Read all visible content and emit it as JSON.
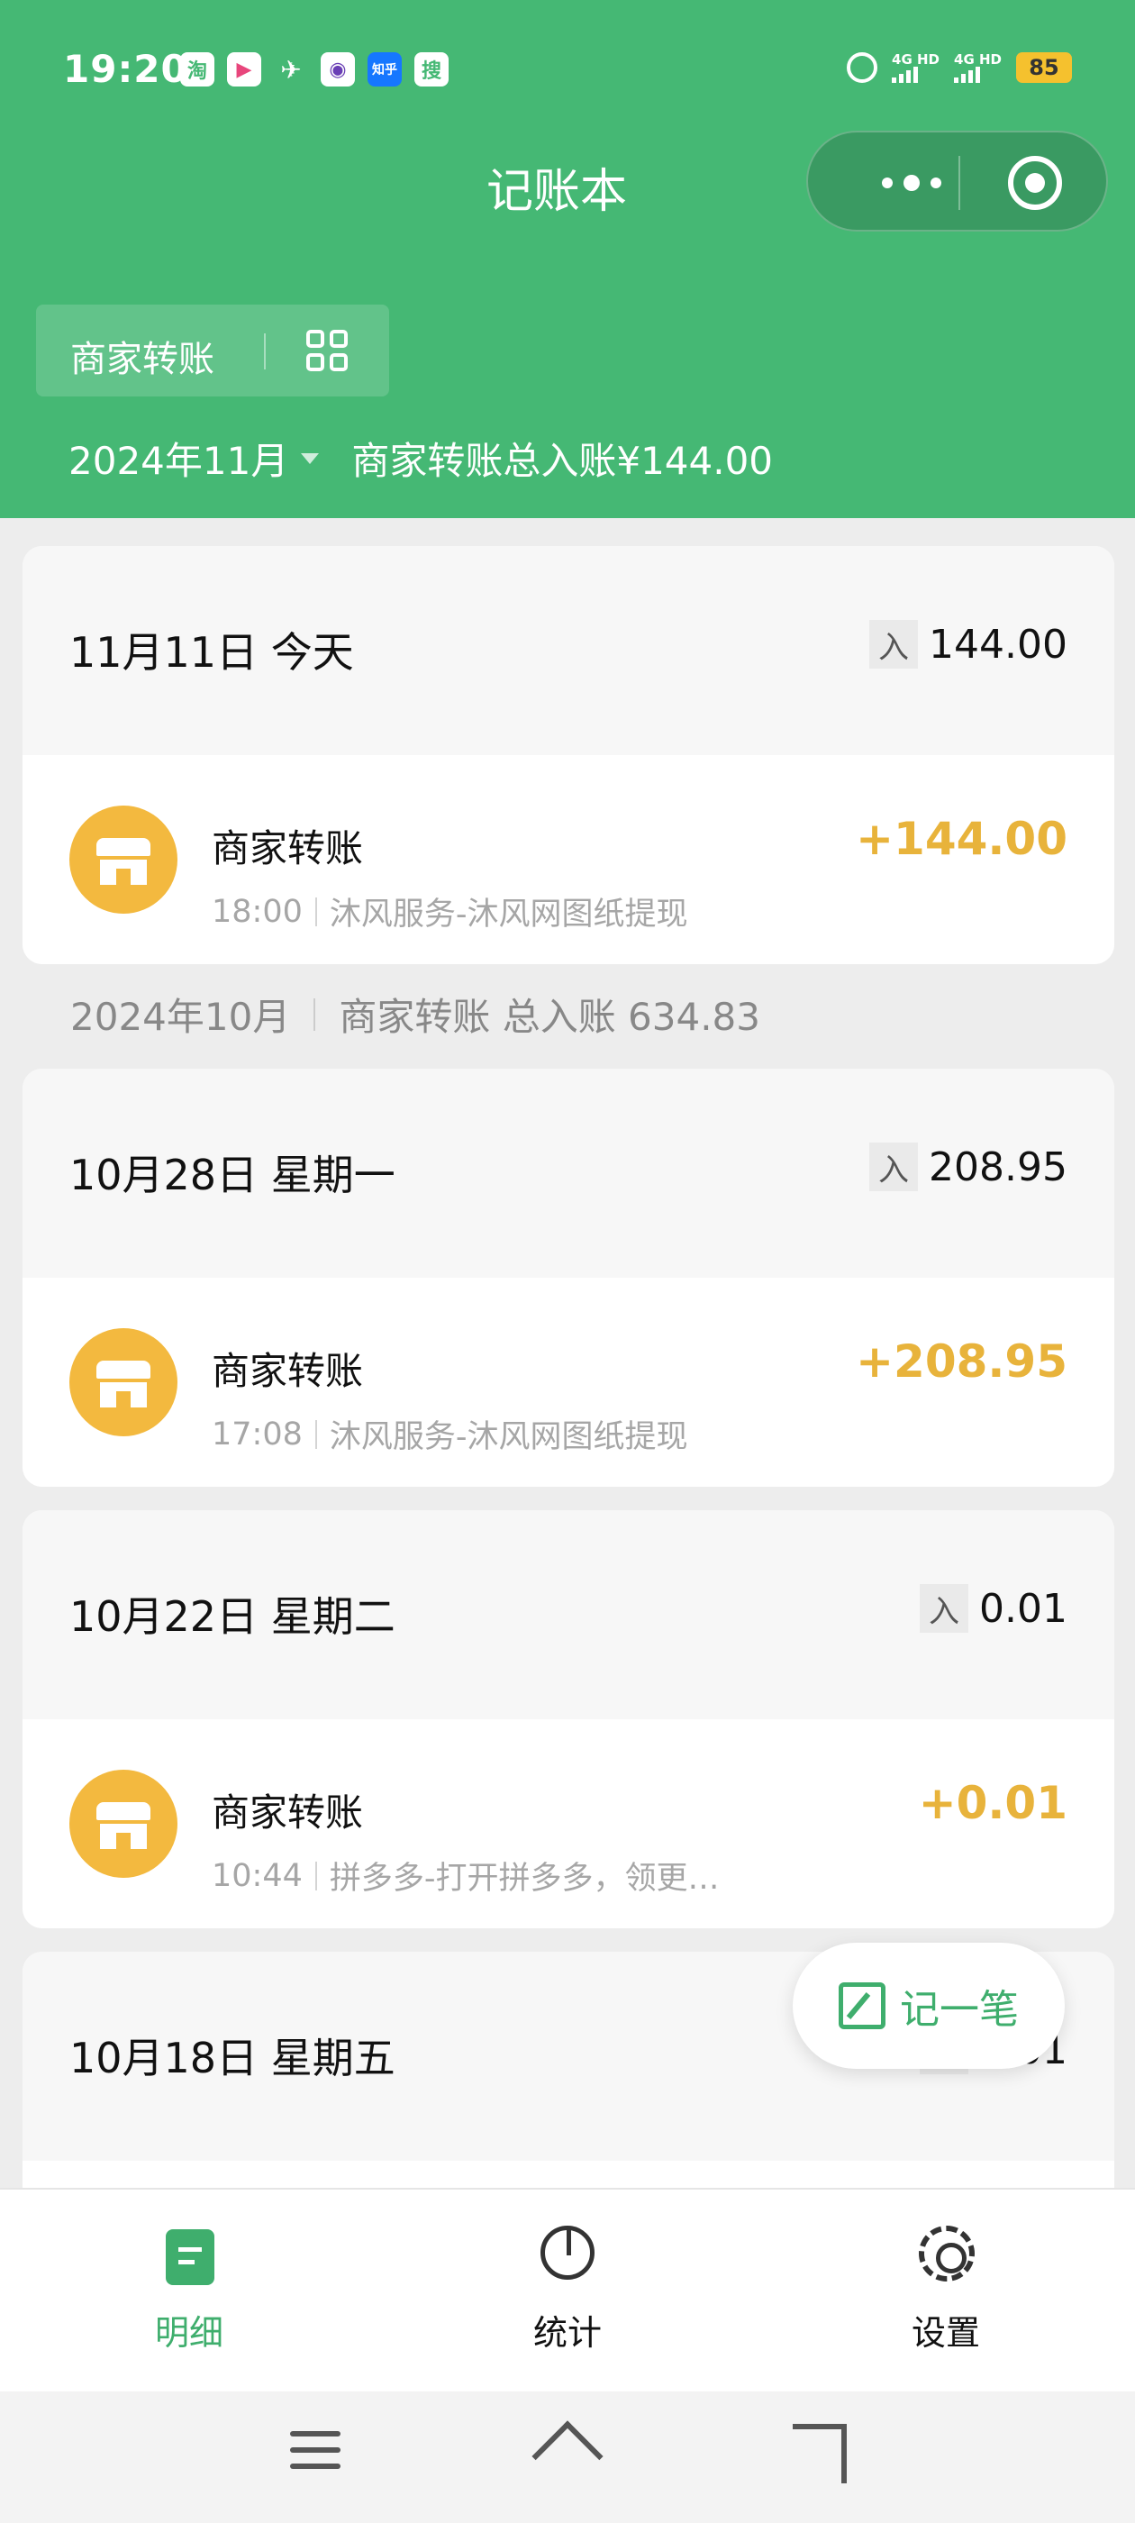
{
  "status_bar": {
    "time": "19:20",
    "notification_icons": [
      "淘",
      "▶",
      "✈",
      "◉",
      "知乎",
      "搜"
    ],
    "network_1": "4G HD",
    "network_2": "4G HD",
    "battery": "85"
  },
  "header": {
    "title": "记账本",
    "filter_label": "商家转账",
    "month": "2024年11月",
    "summary": "商家转账总入账¥144.00"
  },
  "groups": [
    {
      "date": "11月11日 今天",
      "in_badge": "入",
      "total": "144.00",
      "entry": {
        "title": "商家转账",
        "time": "18:00",
        "desc": "沐风服务-沐风网图纸提现",
        "amount": "+144.00"
      }
    },
    {
      "date": "10月28日 星期一",
      "in_badge": "入",
      "total": "208.95",
      "entry": {
        "title": "商家转账",
        "time": "17:08",
        "desc": "沐风服务-沐风网图纸提现",
        "amount": "+208.95"
      }
    },
    {
      "date": "10月22日 星期二",
      "in_badge": "入",
      "total": "0.01",
      "entry": {
        "title": "商家转账",
        "time": "10:44",
        "desc": "拼多多-打开拼多多，领更…",
        "amount": "+0.01"
      }
    },
    {
      "date": "10月18日 星期五",
      "in_badge": "入",
      "total": "0.01"
    }
  ],
  "month_separator": {
    "month": "2024年10月",
    "summary": "商家转账 总入账 634.83"
  },
  "fab_label": "记一笔",
  "tabs": [
    {
      "label": "明细",
      "icon": "document-icon",
      "active": true
    },
    {
      "label": "统计",
      "icon": "pie-chart-icon",
      "active": false
    },
    {
      "label": "设置",
      "icon": "gear-icon",
      "active": false
    }
  ],
  "colors": {
    "header_green": "#45b874",
    "accent_green": "#3fae6d",
    "amount_gold": "#e8b33b",
    "shop_icon": "#f3b93f"
  }
}
